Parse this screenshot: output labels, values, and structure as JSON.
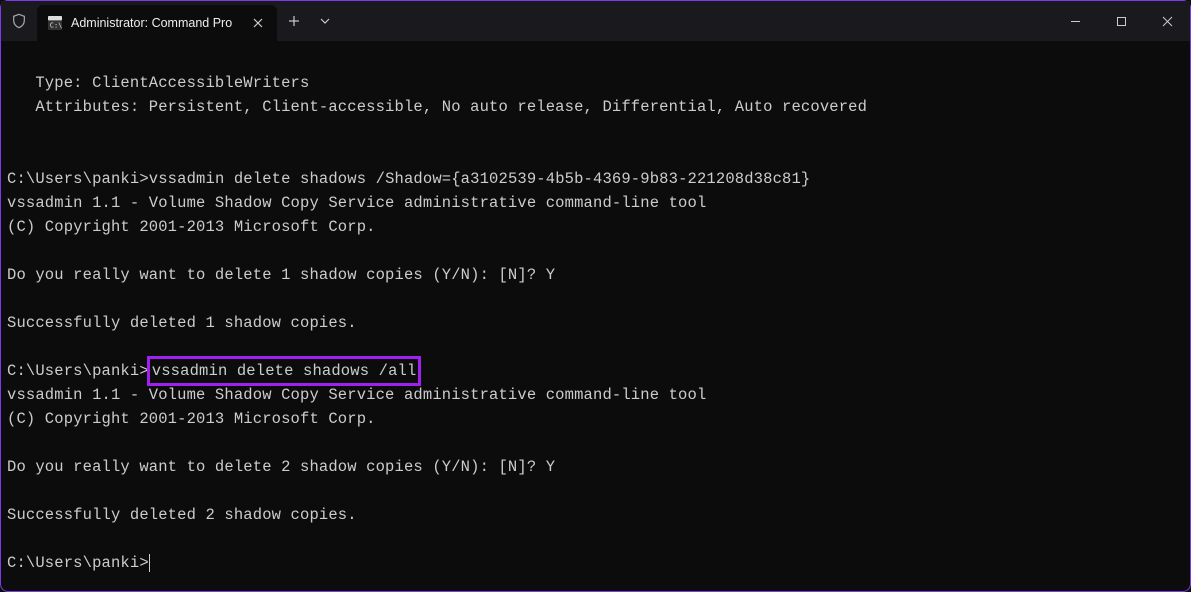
{
  "titlebar": {
    "tab_title": "Administrator: Command Pro"
  },
  "terminal": {
    "line_type": "   Type: ClientAccessibleWriters",
    "line_attr": "   Attributes: Persistent, Client-accessible, No auto release, Differential, Auto recovered",
    "prompt1": "C:\\Users\\panki>",
    "cmd1": "vssadmin delete shadows /Shadow={a3102539-4b5b-4369-9b83-221208d38c81}",
    "vss_header": "vssadmin 1.1 - Volume Shadow Copy Service administrative command-line tool",
    "copyright": "(C) Copyright 2001-2013 Microsoft Corp.",
    "confirm1": "Do you really want to delete 1 shadow copies (Y/N): [N]? Y",
    "success1": "Successfully deleted 1 shadow copies.",
    "prompt2": "C:\\Users\\panki>",
    "cmd2": "vssadmin delete shadows /all",
    "confirm2": "Do you really want to delete 2 shadow copies (Y/N): [N]? Y",
    "success2": "Successfully deleted 2 shadow copies.",
    "prompt3": "C:\\Users\\panki>"
  }
}
